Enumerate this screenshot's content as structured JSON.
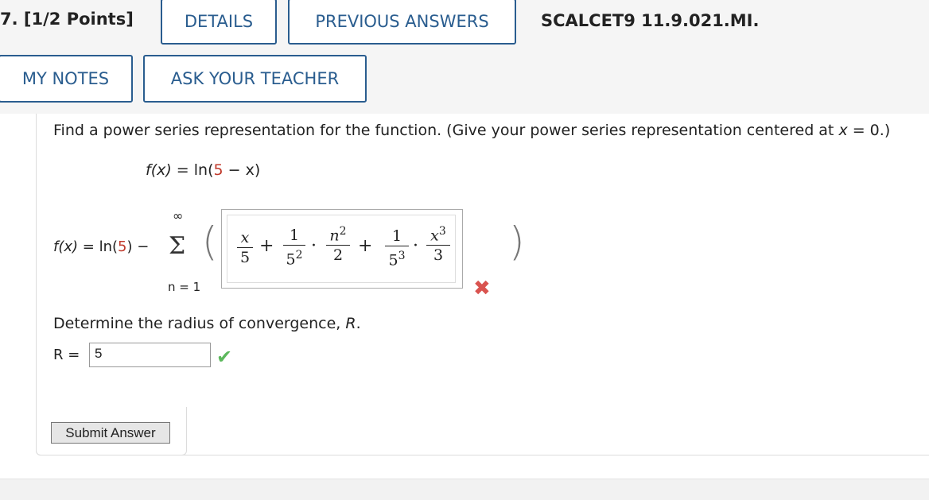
{
  "header": {
    "question_number": "7. [1/2 Points]",
    "details_label": "DETAILS",
    "previous_answers_label": "PREVIOUS ANSWERS",
    "problem_code": "SCALCET9 11.9.021.MI.",
    "my_notes_label": "MY NOTES",
    "ask_teacher_label": "ASK YOUR TEACHER"
  },
  "question": {
    "prompt_pre": "Find a power series representation for the function. (Give your power series representation centered at ",
    "prompt_var": "x",
    "prompt_post": " = 0.)",
    "function_lhs": "f(x)",
    "function_eq": " = ln(",
    "function_const": "5",
    "function_tail": " − x)"
  },
  "series": {
    "lhs": "f(x)",
    "eq": " = ln(",
    "const": "5",
    "tail": ") −",
    "upper": "∞",
    "lower": "n = 1",
    "answer": {
      "term1_num": "x",
      "term1_den": "5",
      "term2_num": "1",
      "term2_den_base": "5",
      "term2_den_exp": "2",
      "term2b_num_base": "n",
      "term2b_num_exp": "2",
      "term2b_den": "2",
      "term3_num": "1",
      "term3_den_base": "5",
      "term3_den_exp": "3",
      "term3b_num_base": "x",
      "term3b_num_exp": "3",
      "term3b_den": "3",
      "plus": "+",
      "dot": "·"
    },
    "status": "incorrect"
  },
  "radius": {
    "prompt": "Determine the radius of convergence, ",
    "prompt_var": "R",
    "prompt_end": ".",
    "label": "R =",
    "value": "5",
    "status": "correct"
  },
  "submit_label": "Submit Answer",
  "colors": {
    "accent": "#2a5d8f",
    "incorrect": "#d9534f",
    "correct": "#5cb85c",
    "constant_red": "#c0392b"
  },
  "icons": {
    "incorrect": "x-mark-icon",
    "correct": "checkmark-icon"
  }
}
